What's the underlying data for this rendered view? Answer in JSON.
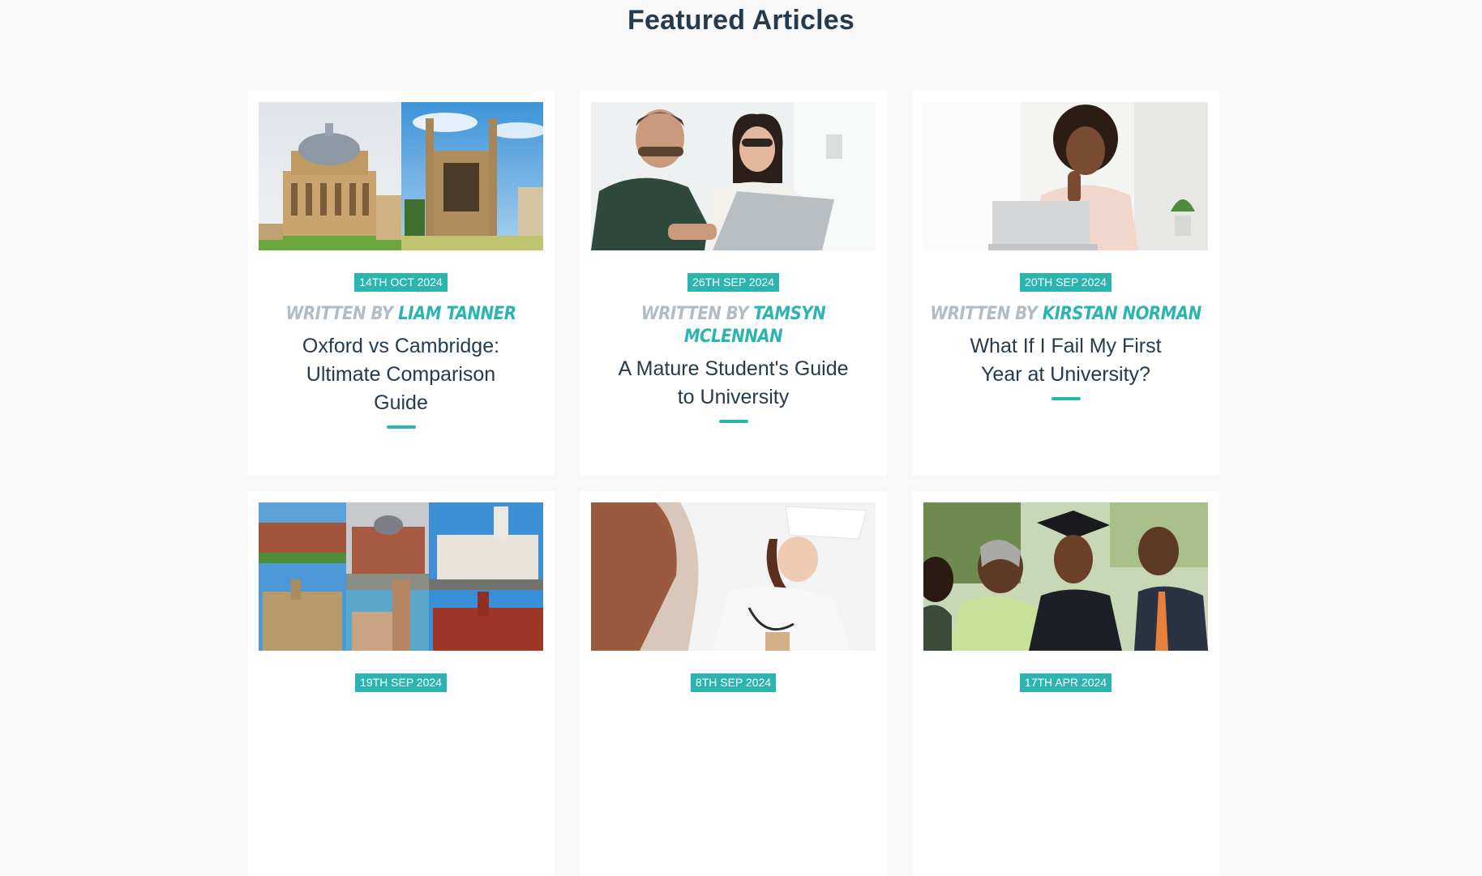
{
  "page": {
    "heading": "Featured Articles",
    "accent_color": "#2bb5b0",
    "heading_color": "#253a4d"
  },
  "articles": [
    {
      "date": "14TH OCT 2024",
      "written_by": "WRITTEN BY",
      "author": "LIAM TANNER",
      "title": "Oxford vs Cambridge: Ultimate Comparison Guide",
      "image": "oxford-cambridge-photo"
    },
    {
      "date": "26TH SEP 2024",
      "written_by": "WRITTEN BY",
      "author": "TAMSYN MCLENNAN",
      "title": "A Mature Student's Guide to University",
      "image": "mature-students-laptop-photo"
    },
    {
      "date": "20TH SEP 2024",
      "written_by": "WRITTEN BY",
      "author": "KIRSTAN NORMAN",
      "title": "What If I Fail My First Year at University?",
      "image": "thoughtful-student-laptop-photo"
    },
    {
      "date": "19TH SEP 2024",
      "image": "university-buildings-collage-photo"
    },
    {
      "date": "8TH SEP 2024",
      "image": "doctor-stethoscope-photo"
    },
    {
      "date": "17TH APR 2024",
      "image": "graduate-family-photo"
    }
  ]
}
